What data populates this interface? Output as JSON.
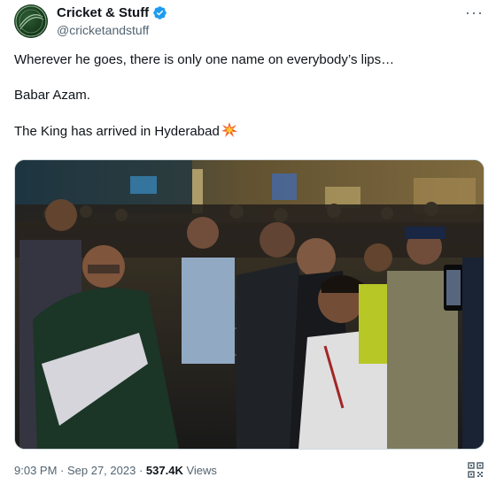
{
  "tweet": {
    "author": {
      "display_name": "Cricket & Stuff",
      "handle": "@cricketandstuff",
      "verified_icon": "verified-badge-icon",
      "avatar_icon": "cricket-ball-logo"
    },
    "more_label": "···",
    "text": {
      "line1": "Wherever he goes, there is only one name on everybody’s lips…",
      "line2": "Babar Azam.",
      "line3": "The King has arrived in Hyderabad",
      "line3_emoji": "collision-emoji-icon"
    },
    "media": {
      "type": "photo",
      "subject": "airport-arrival-crowd"
    },
    "footer": {
      "time": "9:03 PM",
      "separator1": " · ",
      "date": "Sep 27, 2023",
      "separator2": " · ",
      "views_count": "537.4K",
      "views_label": " Views",
      "qr_icon": "qr-code-icon"
    }
  },
  "colors": {
    "text": "#0f1419",
    "secondary": "#536471",
    "verified": "#1d9bf0",
    "border": "#cfd9de"
  }
}
